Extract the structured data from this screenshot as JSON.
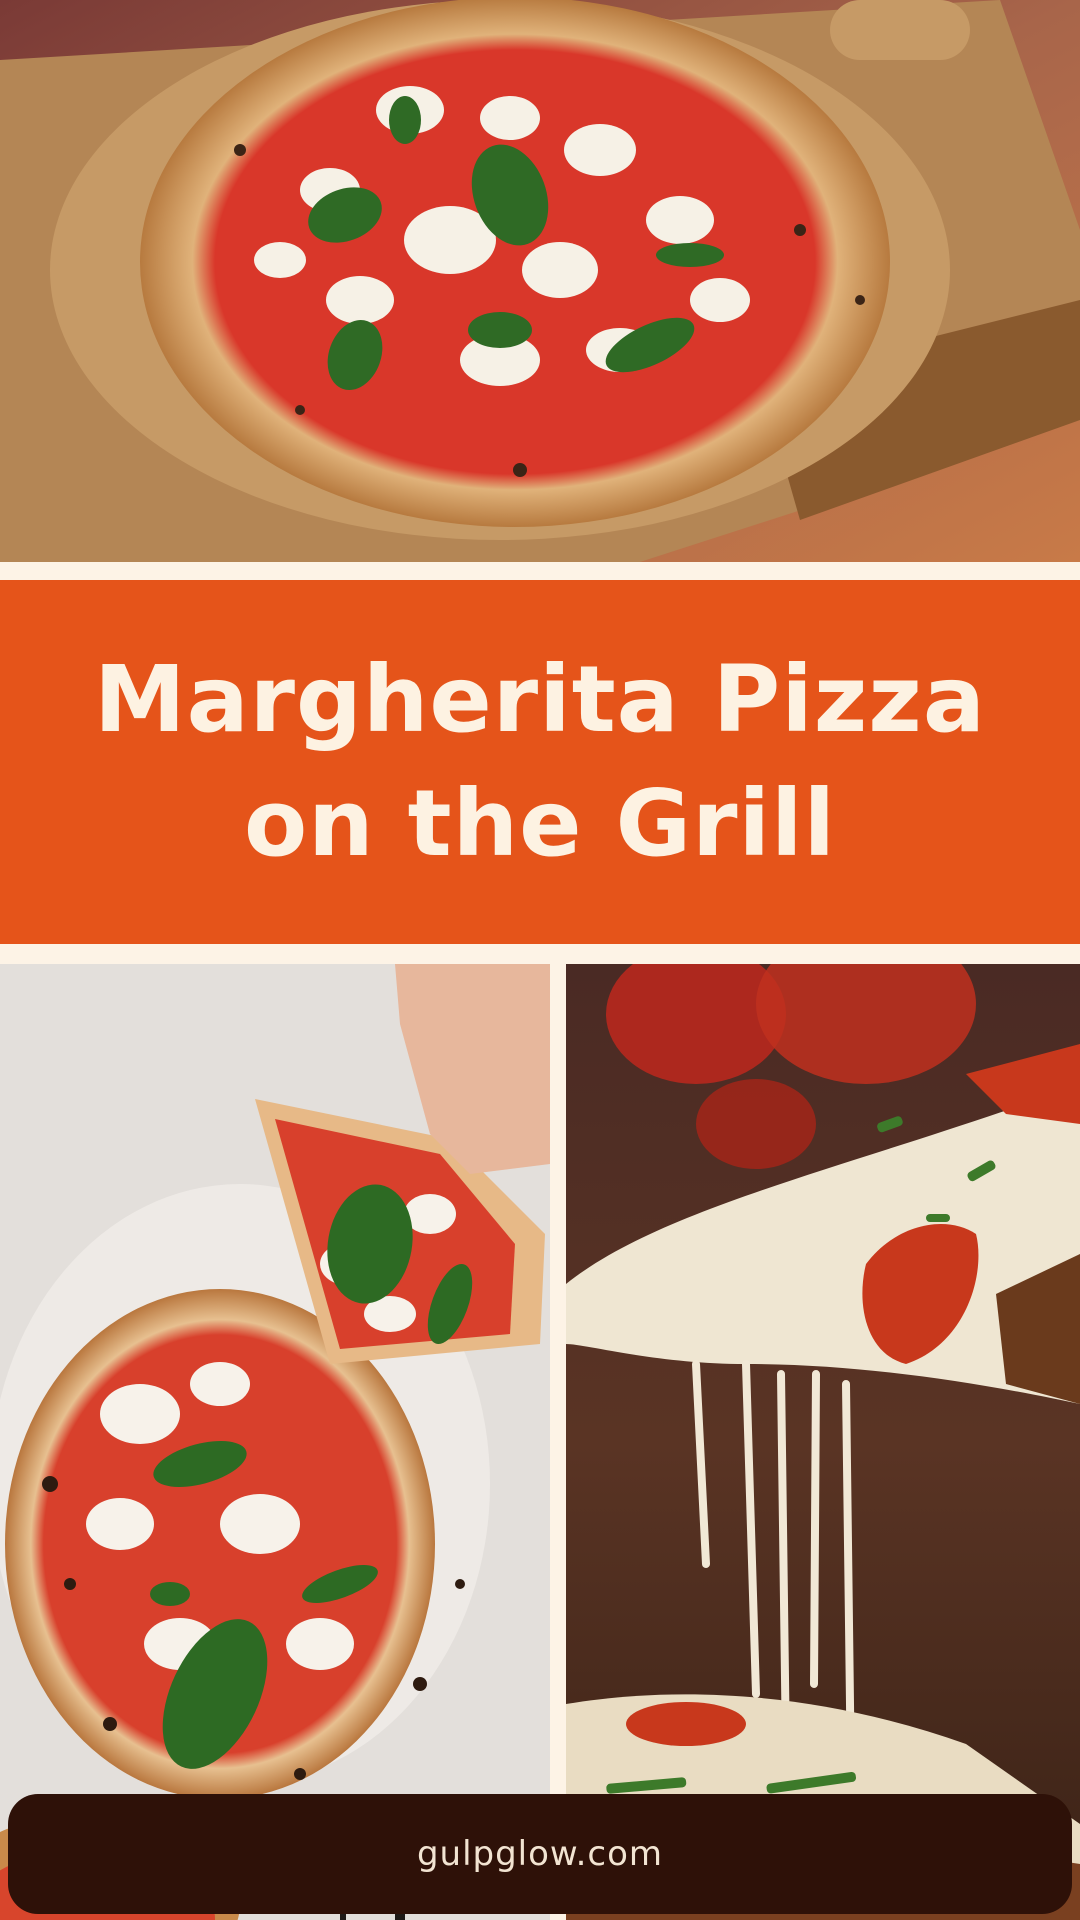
{
  "title": {
    "line1": "Margherita Pizza",
    "line2": "on the Grill"
  },
  "footer": {
    "site": "gulpglow.com"
  },
  "images": {
    "top": "pizza-on-wooden-board-photo",
    "bottom_left": "sliced-pizza-with-hand-photo",
    "bottom_right": "cheese-pull-slice-photo"
  },
  "colors": {
    "background": "#fdf3e6",
    "banner": "#e5541a",
    "title_text": "#fdf2e2",
    "footer_bg": "#2e1108",
    "footer_text": "#f2e4d2"
  }
}
